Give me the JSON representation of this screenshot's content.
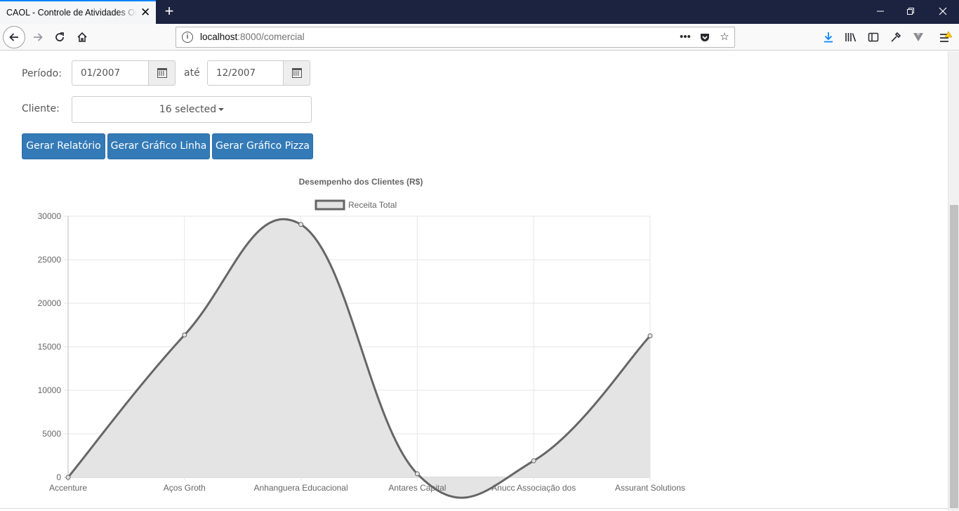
{
  "browser": {
    "tab_title": "CAOL - Controle de Atividades Online",
    "new_tab": "+",
    "url_host": "localhost",
    "url_path": ":8000/comercial"
  },
  "form": {
    "periodo_label": "Período:",
    "date_from": "01/2007",
    "ate_label": "até",
    "date_to": "12/2007",
    "cliente_label": "Cliente:",
    "cliente_selected": "16 selected"
  },
  "buttons": {
    "relatorio": "Gerar Relatório",
    "linha": "Gerar Gráfico Linha",
    "pizza": "Gerar Gráfico Pizza"
  },
  "chart_data": {
    "type": "line",
    "title": "Desempenho dos Clientes (R$)",
    "categories": [
      "Accenture",
      "Aços Groth",
      "Anhanguera Educacional",
      "Antares Capital",
      "Anucc Associação dos",
      "Assurant Solutions"
    ],
    "series": [
      {
        "name": "Receita Total",
        "values": [
          0,
          16350,
          29050,
          400,
          1900,
          16250
        ],
        "fill": "#e3e3e3",
        "stroke": "#666666"
      }
    ],
    "ylim": [
      0,
      30000
    ],
    "yticks": [
      "0",
      "5000",
      "10000",
      "15000",
      "20000",
      "25000",
      "30000"
    ],
    "grid": true,
    "legend_position": "top"
  }
}
